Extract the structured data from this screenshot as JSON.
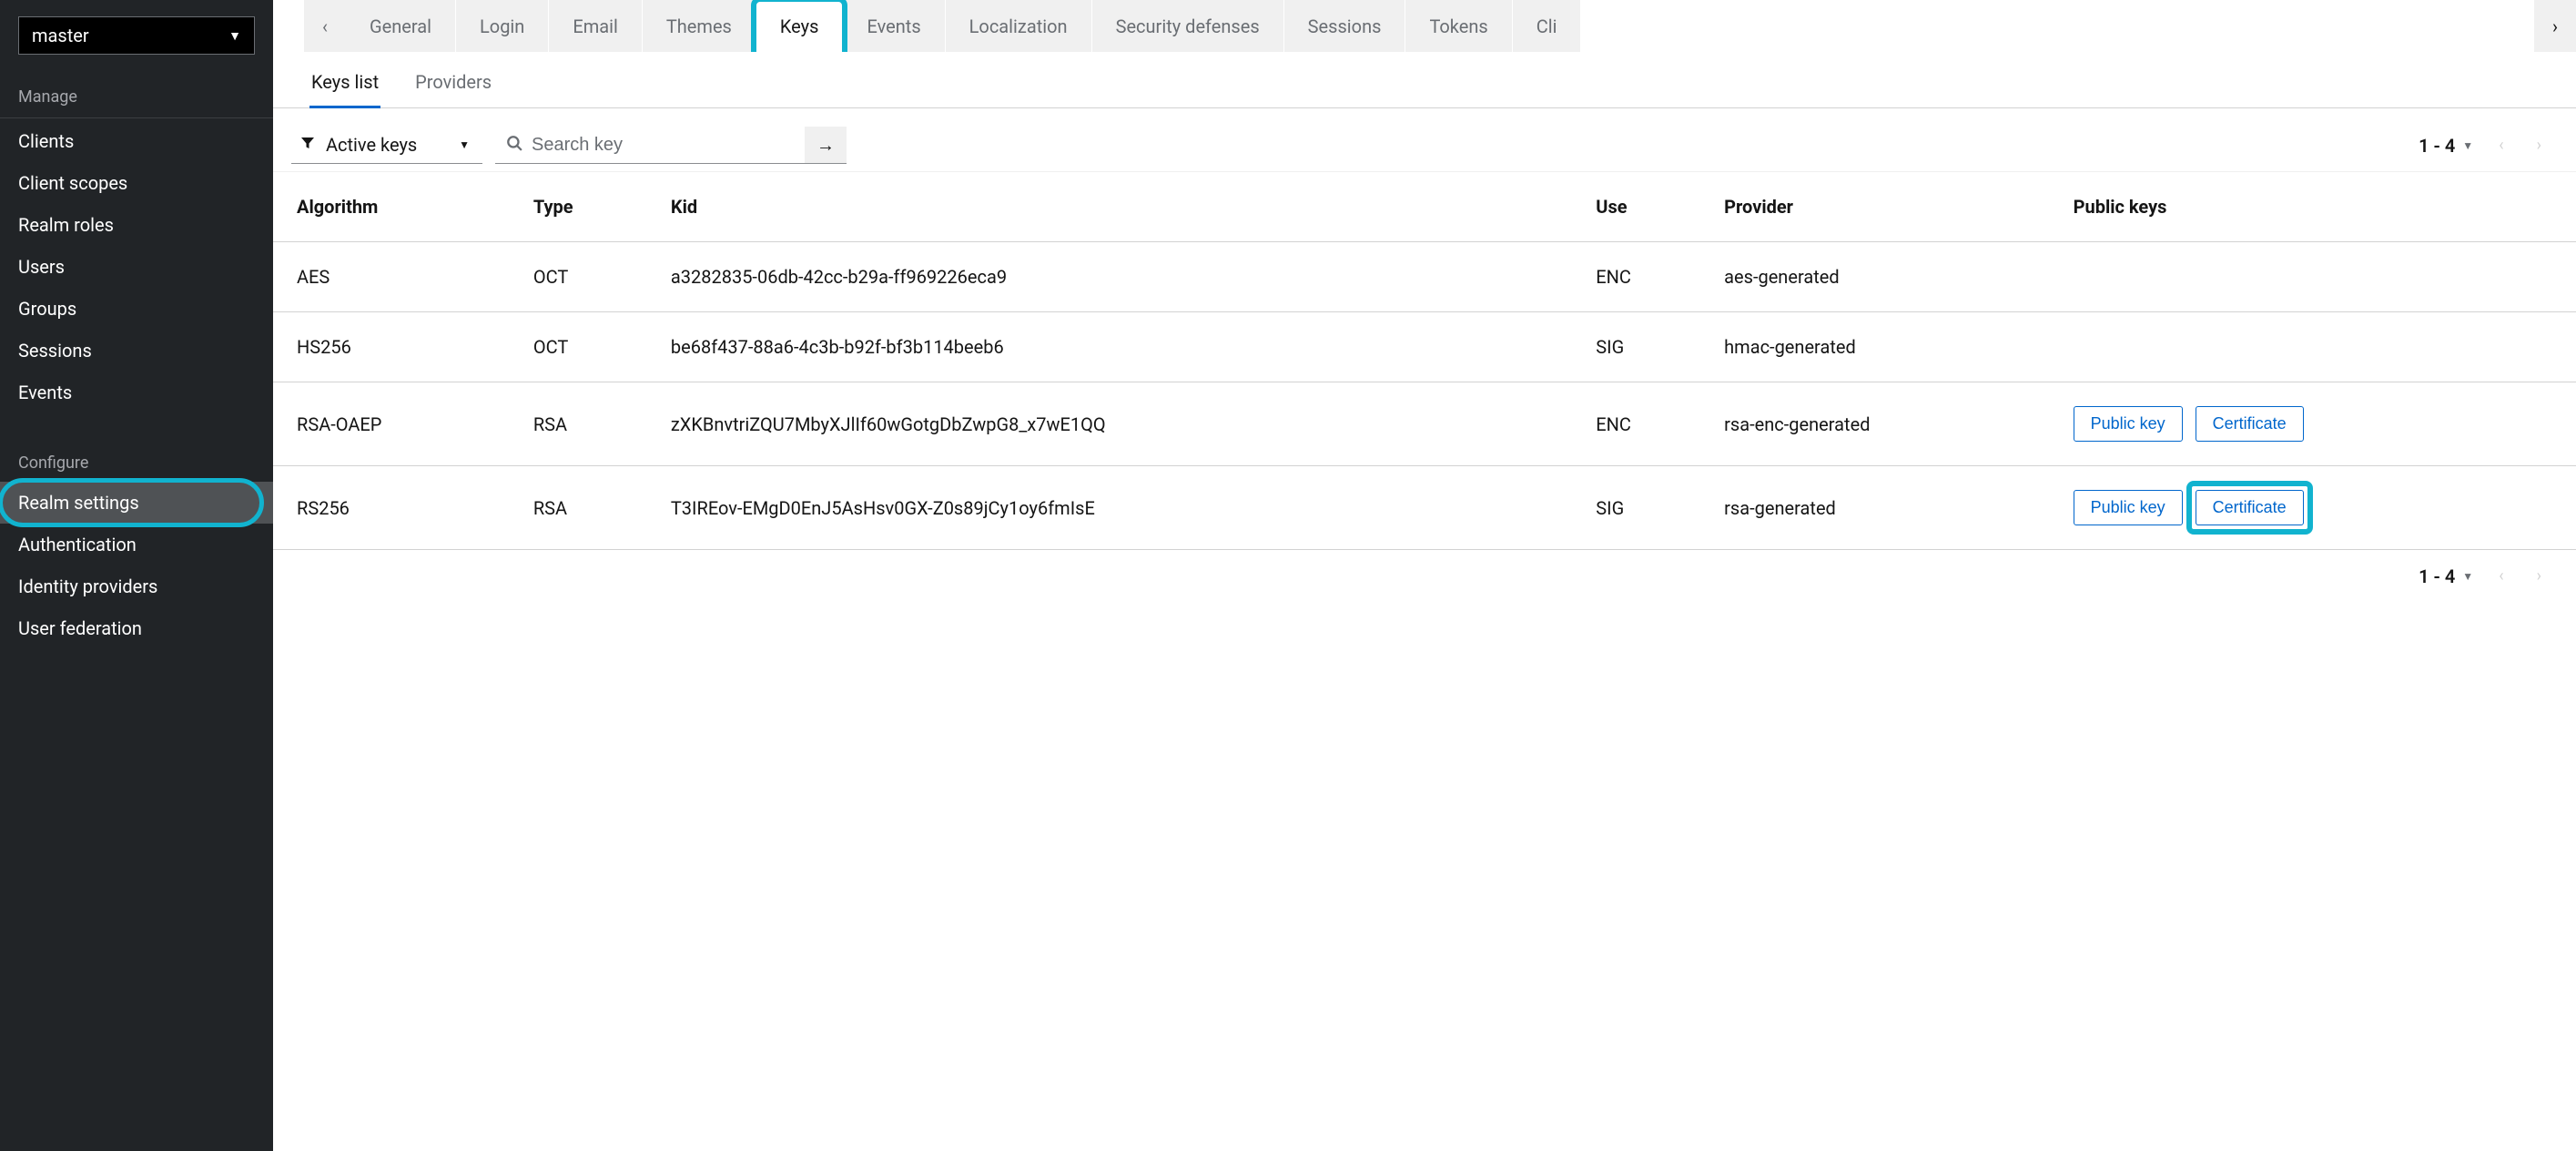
{
  "realmSelector": {
    "value": "master"
  },
  "sidebar": {
    "sections": [
      {
        "label": "Manage",
        "items": [
          {
            "id": "clients",
            "label": "Clients"
          },
          {
            "id": "client-scopes",
            "label": "Client scopes"
          },
          {
            "id": "realm-roles",
            "label": "Realm roles"
          },
          {
            "id": "users",
            "label": "Users"
          },
          {
            "id": "groups",
            "label": "Groups"
          },
          {
            "id": "sessions",
            "label": "Sessions"
          },
          {
            "id": "events",
            "label": "Events"
          }
        ]
      },
      {
        "label": "Configure",
        "items": [
          {
            "id": "realm-settings",
            "label": "Realm settings",
            "active": true,
            "highlighted": true
          },
          {
            "id": "authentication",
            "label": "Authentication"
          },
          {
            "id": "identity-providers",
            "label": "Identity providers"
          },
          {
            "id": "user-federation",
            "label": "User federation"
          }
        ]
      }
    ]
  },
  "tabs": {
    "items": [
      {
        "id": "general",
        "label": "General"
      },
      {
        "id": "login",
        "label": "Login"
      },
      {
        "id": "email",
        "label": "Email"
      },
      {
        "id": "themes",
        "label": "Themes"
      },
      {
        "id": "keys",
        "label": "Keys",
        "active": true,
        "highlighted": true
      },
      {
        "id": "events",
        "label": "Events"
      },
      {
        "id": "localization",
        "label": "Localization"
      },
      {
        "id": "security-defenses",
        "label": "Security defenses"
      },
      {
        "id": "sessions",
        "label": "Sessions"
      },
      {
        "id": "tokens",
        "label": "Tokens"
      },
      {
        "id": "client-policies",
        "label": "Cli"
      }
    ]
  },
  "subtabs": {
    "items": [
      {
        "id": "keys-list",
        "label": "Keys list",
        "active": true
      },
      {
        "id": "providers",
        "label": "Providers"
      }
    ]
  },
  "toolbar": {
    "filterLabel": "Active keys",
    "searchPlaceholder": "Search key"
  },
  "pagination": {
    "text": "1 - 4"
  },
  "table": {
    "headers": {
      "algorithm": "Algorithm",
      "type": "Type",
      "kid": "Kid",
      "use": "Use",
      "provider": "Provider",
      "publicKeys": "Public keys"
    },
    "rows": [
      {
        "algorithm": "AES",
        "type": "OCT",
        "kid": "a3282835-06db-42cc-b29a-ff969226eca9",
        "use": "ENC",
        "provider": "aes-generated",
        "hasKeys": false
      },
      {
        "algorithm": "HS256",
        "type": "OCT",
        "kid": "be68f437-88a6-4c3b-b92f-bf3b114beeb6",
        "use": "SIG",
        "provider": "hmac-generated",
        "hasKeys": false
      },
      {
        "algorithm": "RSA-OAEP",
        "type": "RSA",
        "kid": "zXKBnvtriZQU7MbyXJlIf60wGotgDbZwpG8_x7wE1QQ",
        "use": "ENC",
        "provider": "rsa-enc-generated",
        "hasKeys": true
      },
      {
        "algorithm": "RS256",
        "type": "RSA",
        "kid": "T3IREov-EMgD0EnJ5AsHsv0GX-Z0s89jCy1oy6fmIsE",
        "use": "SIG",
        "provider": "rsa-generated",
        "hasKeys": true,
        "certHighlighted": true
      }
    ]
  },
  "buttons": {
    "publicKey": "Public key",
    "certificate": "Certificate"
  }
}
